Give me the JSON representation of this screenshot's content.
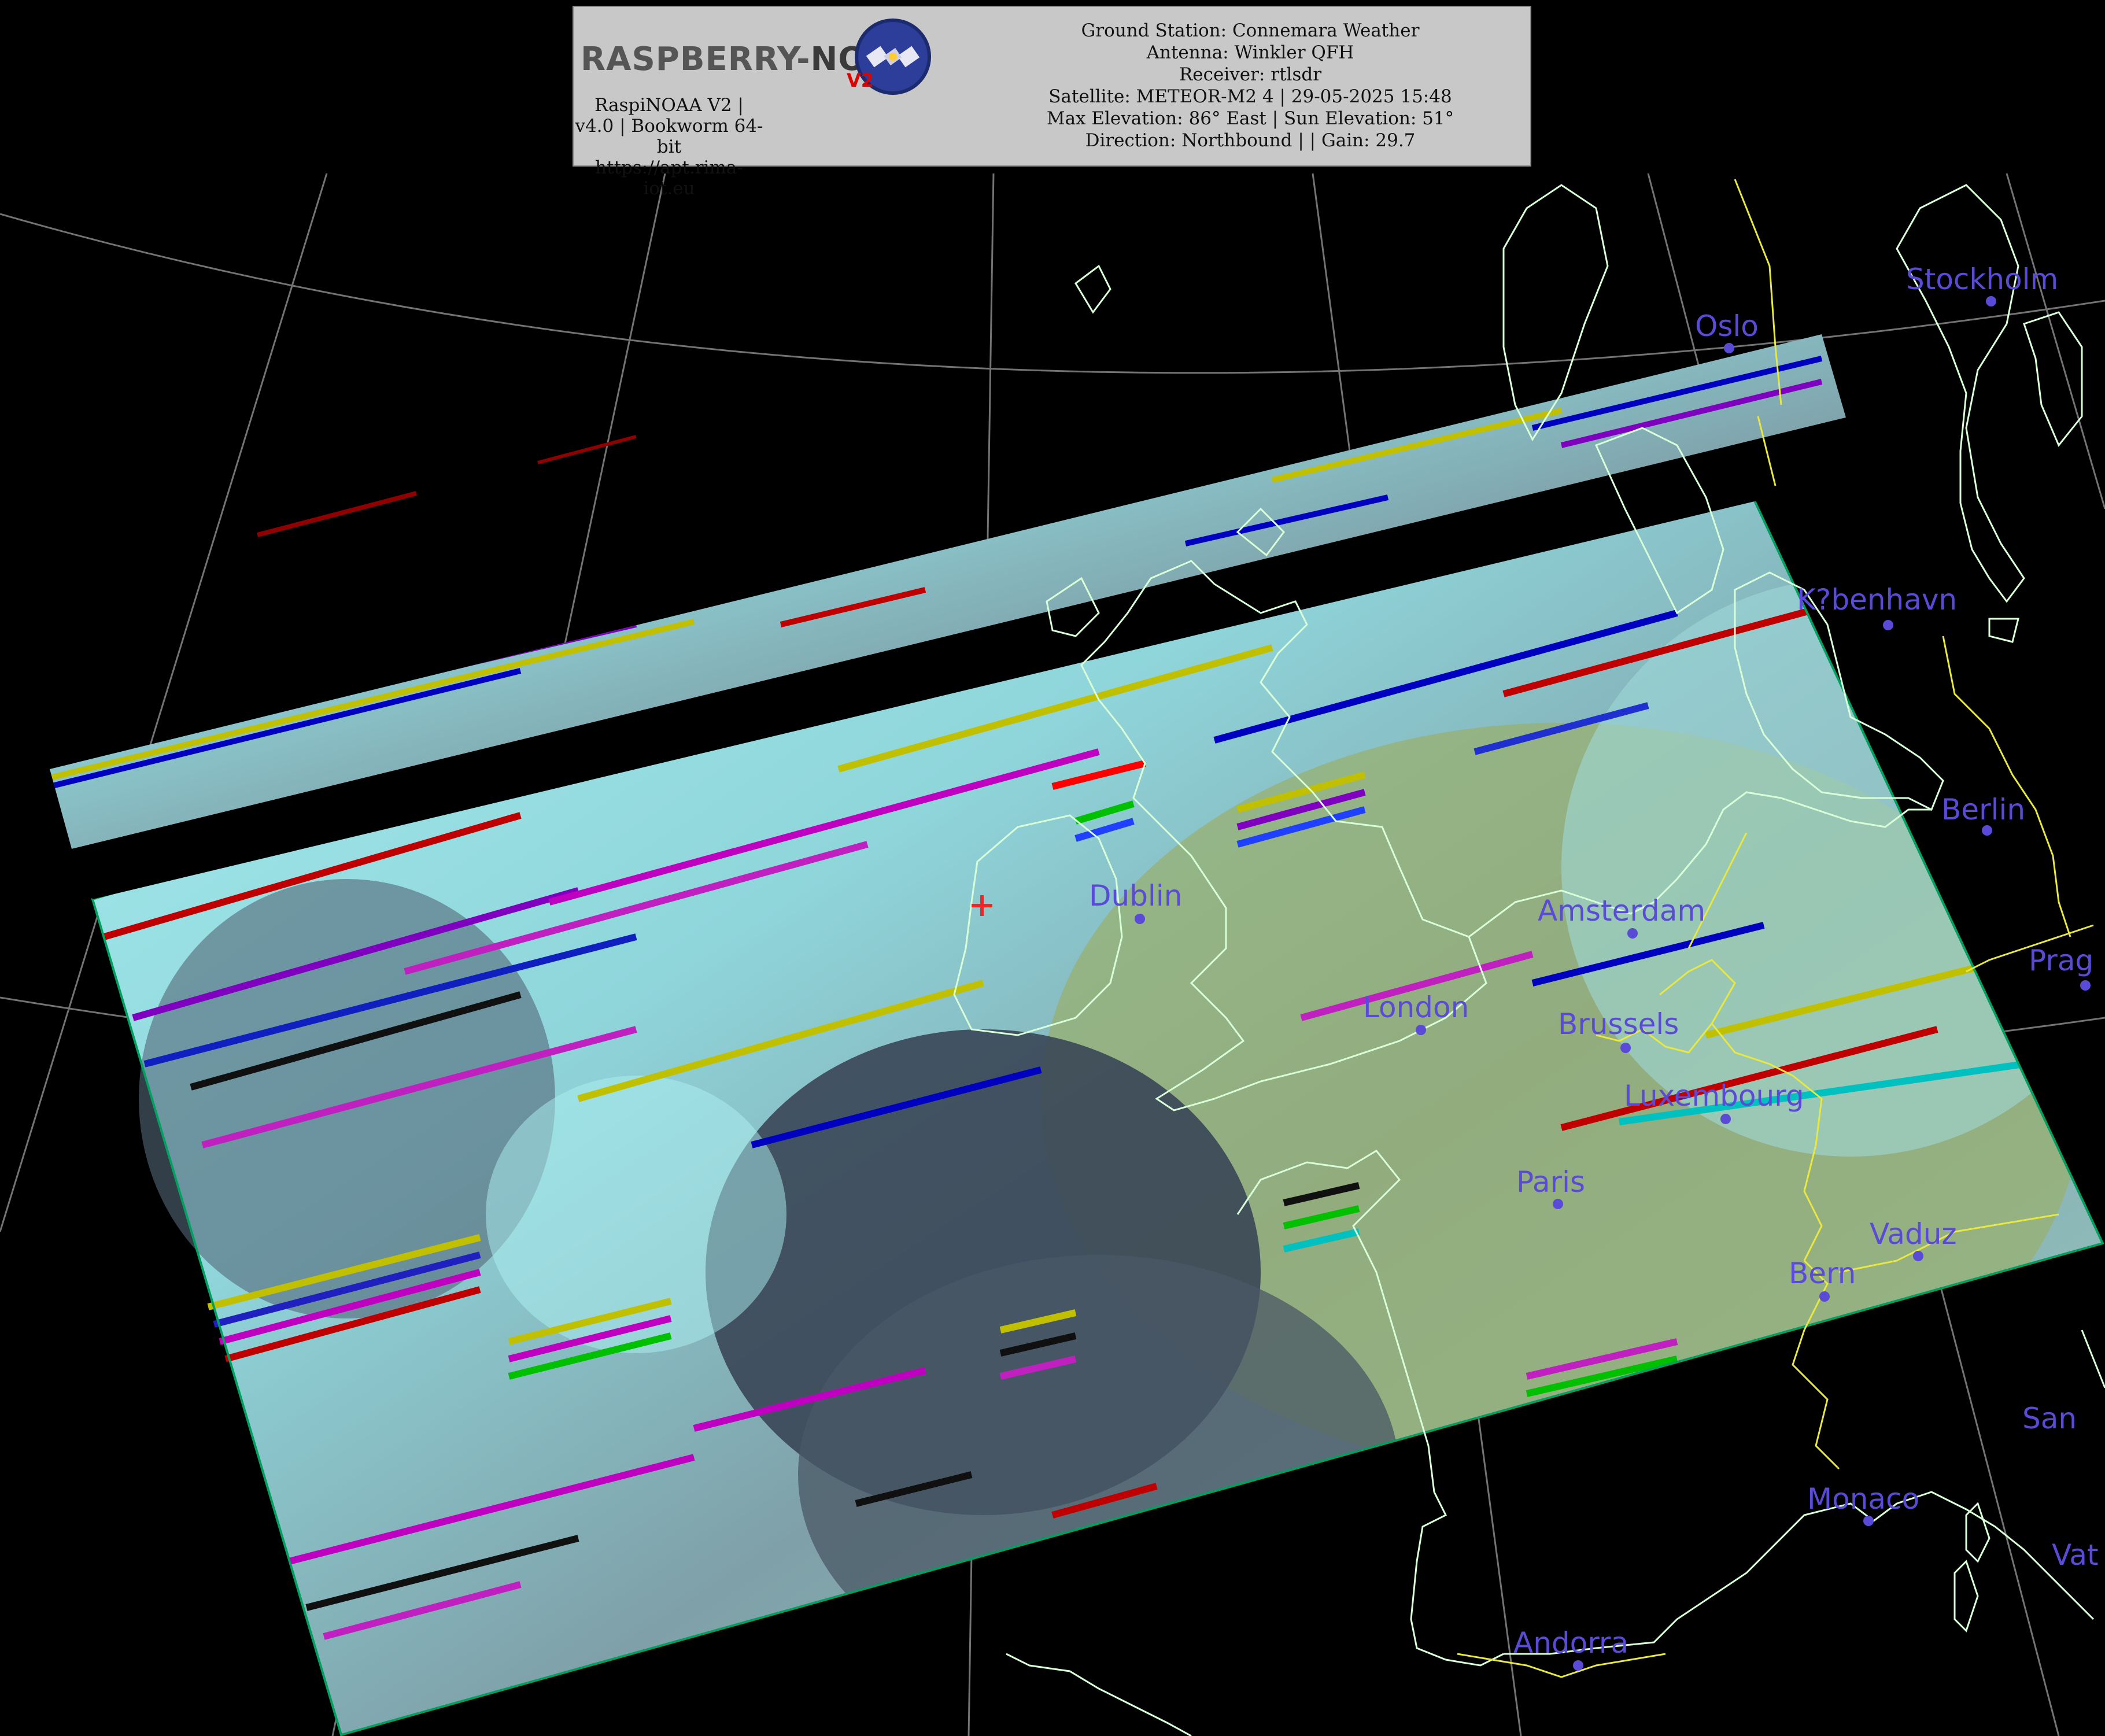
{
  "header": {
    "logo_text_main": "RASPBERRY-",
    "logo_text_noaa": "NOAA",
    "logo_v2": "V2",
    "software_line": "RaspiNOAA V2 | v4.0 | Bookworm 64-bit",
    "url": "https://apt.rima-iot.eu",
    "ground_station": "Ground Station: Connemara Weather",
    "antenna": "Antenna: Winkler QFH",
    "receiver": "Receiver: rtlsdr",
    "satellite": "Satellite: METEOR-M2 4 | 29-05-2025 15:48",
    "elevation": "Max Elevation: 86° East | Sun Elevation: 51°",
    "direction": "Direction: Northbound | | Gain: 29.7"
  },
  "map": {
    "colors": {
      "background": "#000000",
      "coastline": "#d8ffd8",
      "borders": "#e8e840",
      "graticule": "#aaaaaa",
      "city_label": "#5a4ad8",
      "cloud": "#9fe3e6",
      "land": "#8aa860",
      "sea": "#2e3644"
    },
    "cities": [
      {
        "id": "stockholm",
        "label": "Stockholm"
      },
      {
        "id": "oslo",
        "label": "Oslo"
      },
      {
        "id": "kobenhavn",
        "label": "K?benhavn"
      },
      {
        "id": "berlin",
        "label": "Berlin"
      },
      {
        "id": "prague",
        "label": "Prag"
      },
      {
        "id": "dublin",
        "label": "Dublin"
      },
      {
        "id": "amsterdam",
        "label": "Amsterdam"
      },
      {
        "id": "london",
        "label": "London"
      },
      {
        "id": "brussels",
        "label": "Brussels"
      },
      {
        "id": "luxembourg",
        "label": "Luxembourg"
      },
      {
        "id": "paris",
        "label": "Paris"
      },
      {
        "id": "vaduz",
        "label": "Vaduz"
      },
      {
        "id": "bern",
        "label": "Bern"
      },
      {
        "id": "san_marino",
        "label": "San"
      },
      {
        "id": "monaco",
        "label": "Monaco"
      },
      {
        "id": "vatican",
        "label": "Vat"
      },
      {
        "id": "andorra",
        "label": "Andorra"
      }
    ],
    "station_marker": "+"
  }
}
